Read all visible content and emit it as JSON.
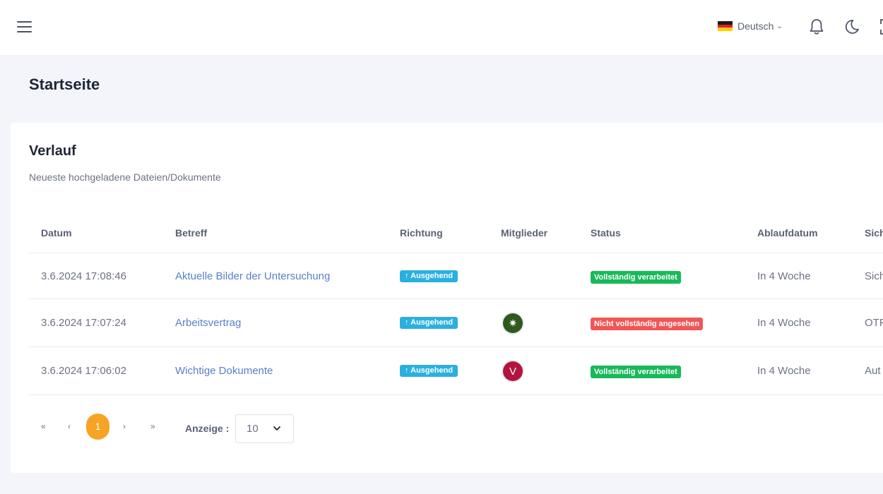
{
  "header": {
    "language": {
      "label": "Deutsch",
      "flag_colors": [
        "#1a1a1a",
        "#dd1f26",
        "#ffce00"
      ]
    },
    "icons": [
      "menu-icon",
      "bell-icon",
      "moon-icon",
      "fullscreen-icon"
    ]
  },
  "page": {
    "title": "Startseite"
  },
  "history": {
    "title": "Verlauf",
    "subtitle": "Neueste hochgeladene Dateien/Dokumente",
    "columns": [
      "Datum",
      "Betreff",
      "Richtung",
      "Mitglieder",
      "Status",
      "Ablaufdatum",
      "Sich"
    ],
    "rows": [
      {
        "date": "3.6.2024 17:08:46",
        "subject": "Aktuelle Bilder der Untersuchung",
        "direction": "↑ Ausgehend",
        "members": [],
        "status": "Vollständig verarbeitet",
        "expiry": "In 4 Woche",
        "security": "Sich"
      },
      {
        "date": "3.6.2024 17:07:24",
        "subject": "Arbeitsvertrag",
        "direction": "↑ Ausgehend",
        "members": [
          {
            "initial": "✷",
            "color": "#2e5a1d"
          }
        ],
        "status": "Nicht vollständig angesehen",
        "expiry": "In 4 Woche",
        "security": "OTF"
      },
      {
        "date": "3.6.2024 17:06:02",
        "subject": "Wichtige Dokumente",
        "direction": "↑ Ausgehend",
        "members": [
          {
            "initial": "V",
            "color": "#b3143f"
          }
        ],
        "status": "Vollständig verarbeitet",
        "expiry": "In 4 Woche",
        "security": "Aut"
      }
    ]
  },
  "pagination": {
    "first": "«",
    "prev": "‹",
    "current": "1",
    "next": "›",
    "last": "»",
    "show_label": "Anzeige :",
    "page_size": "10"
  },
  "colors": {
    "accent": "#f7a324",
    "link": "#5a7fc9",
    "badge_direction": "#2ab0e0",
    "badge_success": "#18b95a",
    "badge_warning": "#f05656"
  }
}
